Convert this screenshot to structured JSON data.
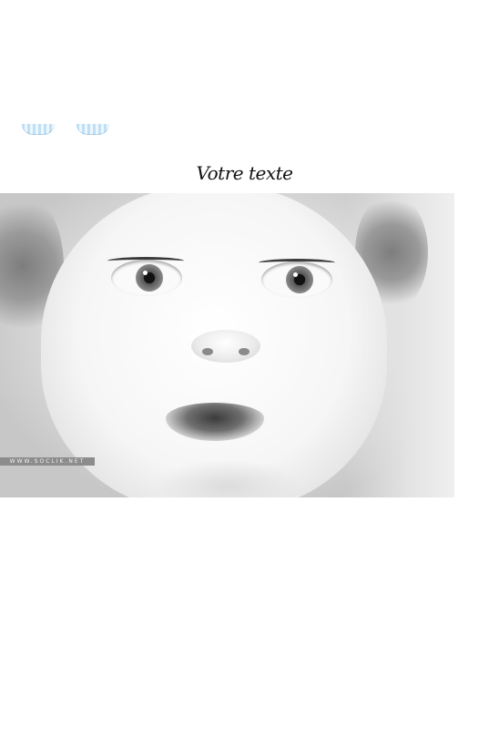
{
  "headline": "Votre texte",
  "photo": {
    "watermark": "WWW.SOCLIK.NET"
  }
}
